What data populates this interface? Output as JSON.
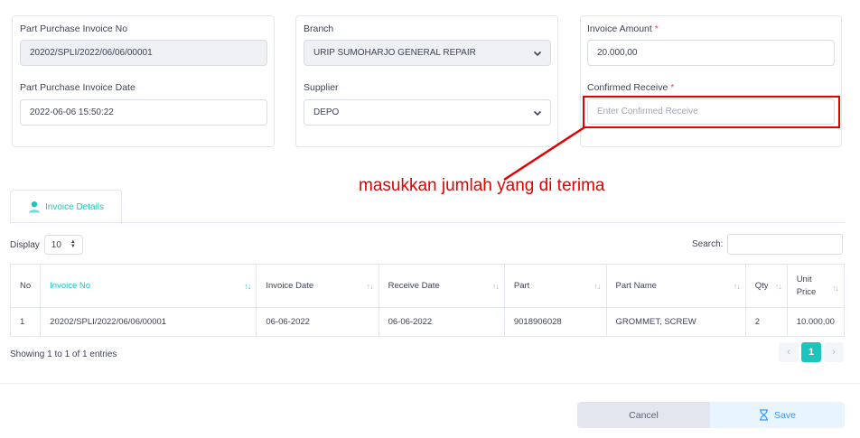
{
  "form": {
    "part_purchase_invoice_no": {
      "label": "Part Purchase Invoice No",
      "value": "20202/SPLI/2022/06/06/00001"
    },
    "part_purchase_invoice_date": {
      "label": "Part Purchase Invoice Date",
      "value": "2022-06-06 15:50:22"
    },
    "branch": {
      "label": "Branch",
      "value": "URIP SUMOHARJO GENERAL REPAIR"
    },
    "supplier": {
      "label": "Supplier",
      "value": "DEPO"
    },
    "invoice_amount": {
      "label": "Invoice Amount",
      "required_mark": "*",
      "value": "20.000,00"
    },
    "confirmed_receive": {
      "label": "Confirmed Receive",
      "required_mark": "*",
      "placeholder": "Enter Confirmed Receive"
    }
  },
  "annotation": {
    "text": "masukkan jumlah yang di terima",
    "color": "#e30000"
  },
  "tabs": [
    {
      "label": "Invoice Details",
      "icon": "user-icon"
    }
  ],
  "table_controls": {
    "display_label": "Display",
    "page_size": "10",
    "search_label": "Search:"
  },
  "table": {
    "columns": [
      "No",
      "Invoice No",
      "Invoice Date",
      "Receive Date",
      "Part",
      "Part Name",
      "Qty",
      "Unit Price"
    ],
    "rows": [
      [
        "1",
        "20202/SPLI/2022/06/06/00001",
        "06-06-2022",
        "06-06-2022",
        "9018906028",
        "GROMMET, SCREW",
        "2",
        "10.000,00"
      ]
    ]
  },
  "footer": {
    "showing": "Showing 1 to 1 of 1 entries",
    "current_page": "1",
    "prev": "‹",
    "next": "›"
  },
  "actions": {
    "cancel": "Cancel",
    "save": "Save"
  },
  "colors": {
    "accent": "#1bc5bd",
    "primary": "#3699ff",
    "danger": "#f1416c"
  }
}
